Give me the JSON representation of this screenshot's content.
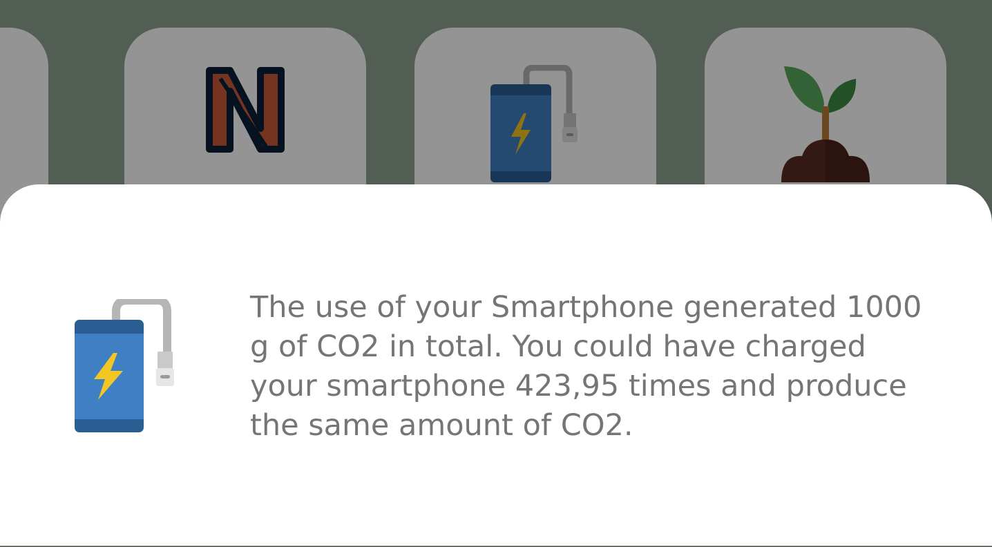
{
  "background": {
    "cards": [
      {
        "icon": "partial-card"
      },
      {
        "icon": "n-letter-icon"
      },
      {
        "icon": "smartphone-charging-icon"
      },
      {
        "icon": "plant-sprout-icon"
      }
    ],
    "bg_color": "#8da08f",
    "scrim_color": "rgba(0,0,0,0.42)"
  },
  "sheet": {
    "icon": "smartphone-charging-icon",
    "message": "The use of your Smartphone generated 1000 g of CO2 in total. You could have charged your smartphone 423,95 times and produce the same amount of CO2."
  },
  "colors": {
    "phone_body": "#3f80c4",
    "phone_band": "#2a5e93",
    "bolt": "#f3c623",
    "cable": "#b5b5b5",
    "n_fill": "#c85a3a",
    "n_stroke": "#0b2036",
    "leaf": "#5aa960",
    "soil": "#5b2a24"
  }
}
